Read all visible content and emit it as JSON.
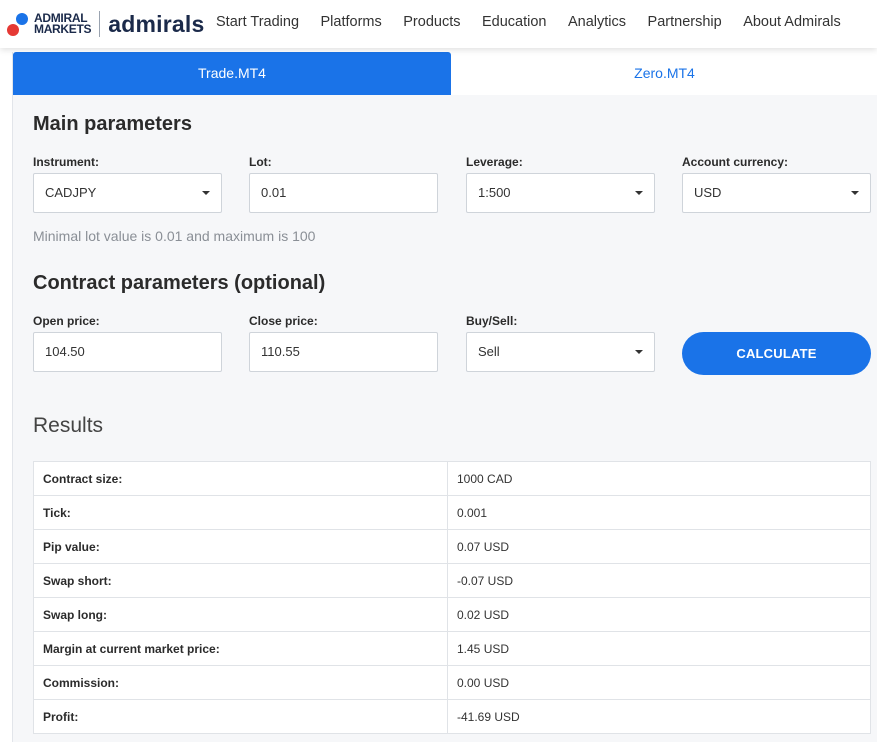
{
  "brand": {
    "logo_line1": "ADMIRAL",
    "logo_line2": "MARKETS",
    "wordmark": "admirals",
    "colors": {
      "blue": "#1a73e8",
      "red": "#e53935",
      "navy": "#1b2a4a"
    }
  },
  "nav": {
    "items": [
      {
        "label": "Start Trading"
      },
      {
        "label": "Platforms"
      },
      {
        "label": "Products"
      },
      {
        "label": "Education"
      },
      {
        "label": "Analytics"
      },
      {
        "label": "Partnership"
      },
      {
        "label": "About Admirals"
      }
    ]
  },
  "tabs": [
    {
      "label": "Trade.MT4",
      "active": true
    },
    {
      "label": "Zero.MT4",
      "active": false
    }
  ],
  "main": {
    "title": "Main parameters",
    "instrument": {
      "label": "Instrument:",
      "value": "CADJPY"
    },
    "lot": {
      "label": "Lot:",
      "value": "0.01"
    },
    "leverage": {
      "label": "Leverage:",
      "value": "1:500"
    },
    "currency": {
      "label": "Account currency:",
      "value": "USD"
    },
    "hint": "Minimal lot value is 0.01 and maximum is 100"
  },
  "contract": {
    "title": "Contract parameters (optional)",
    "open_price": {
      "label": "Open price:",
      "value": "104.50"
    },
    "close_price": {
      "label": "Close price:",
      "value": "110.55"
    },
    "buy_sell": {
      "label": "Buy/Sell:",
      "value": "Sell"
    },
    "calculate_label": "CALCULATE"
  },
  "results": {
    "title": "Results",
    "rows": [
      {
        "key": "Contract size:",
        "value": "1000 CAD"
      },
      {
        "key": "Tick:",
        "value": "0.001"
      },
      {
        "key": "Pip value:",
        "value": "0.07 USD"
      },
      {
        "key": "Swap short:",
        "value": "-0.07 USD"
      },
      {
        "key": "Swap long:",
        "value": "0.02 USD"
      },
      {
        "key": "Margin at current market price:",
        "value": "1.45 USD"
      },
      {
        "key": "Commission:",
        "value": "0.00 USD"
      },
      {
        "key": "Profit:",
        "value": "-41.69 USD"
      }
    ]
  }
}
